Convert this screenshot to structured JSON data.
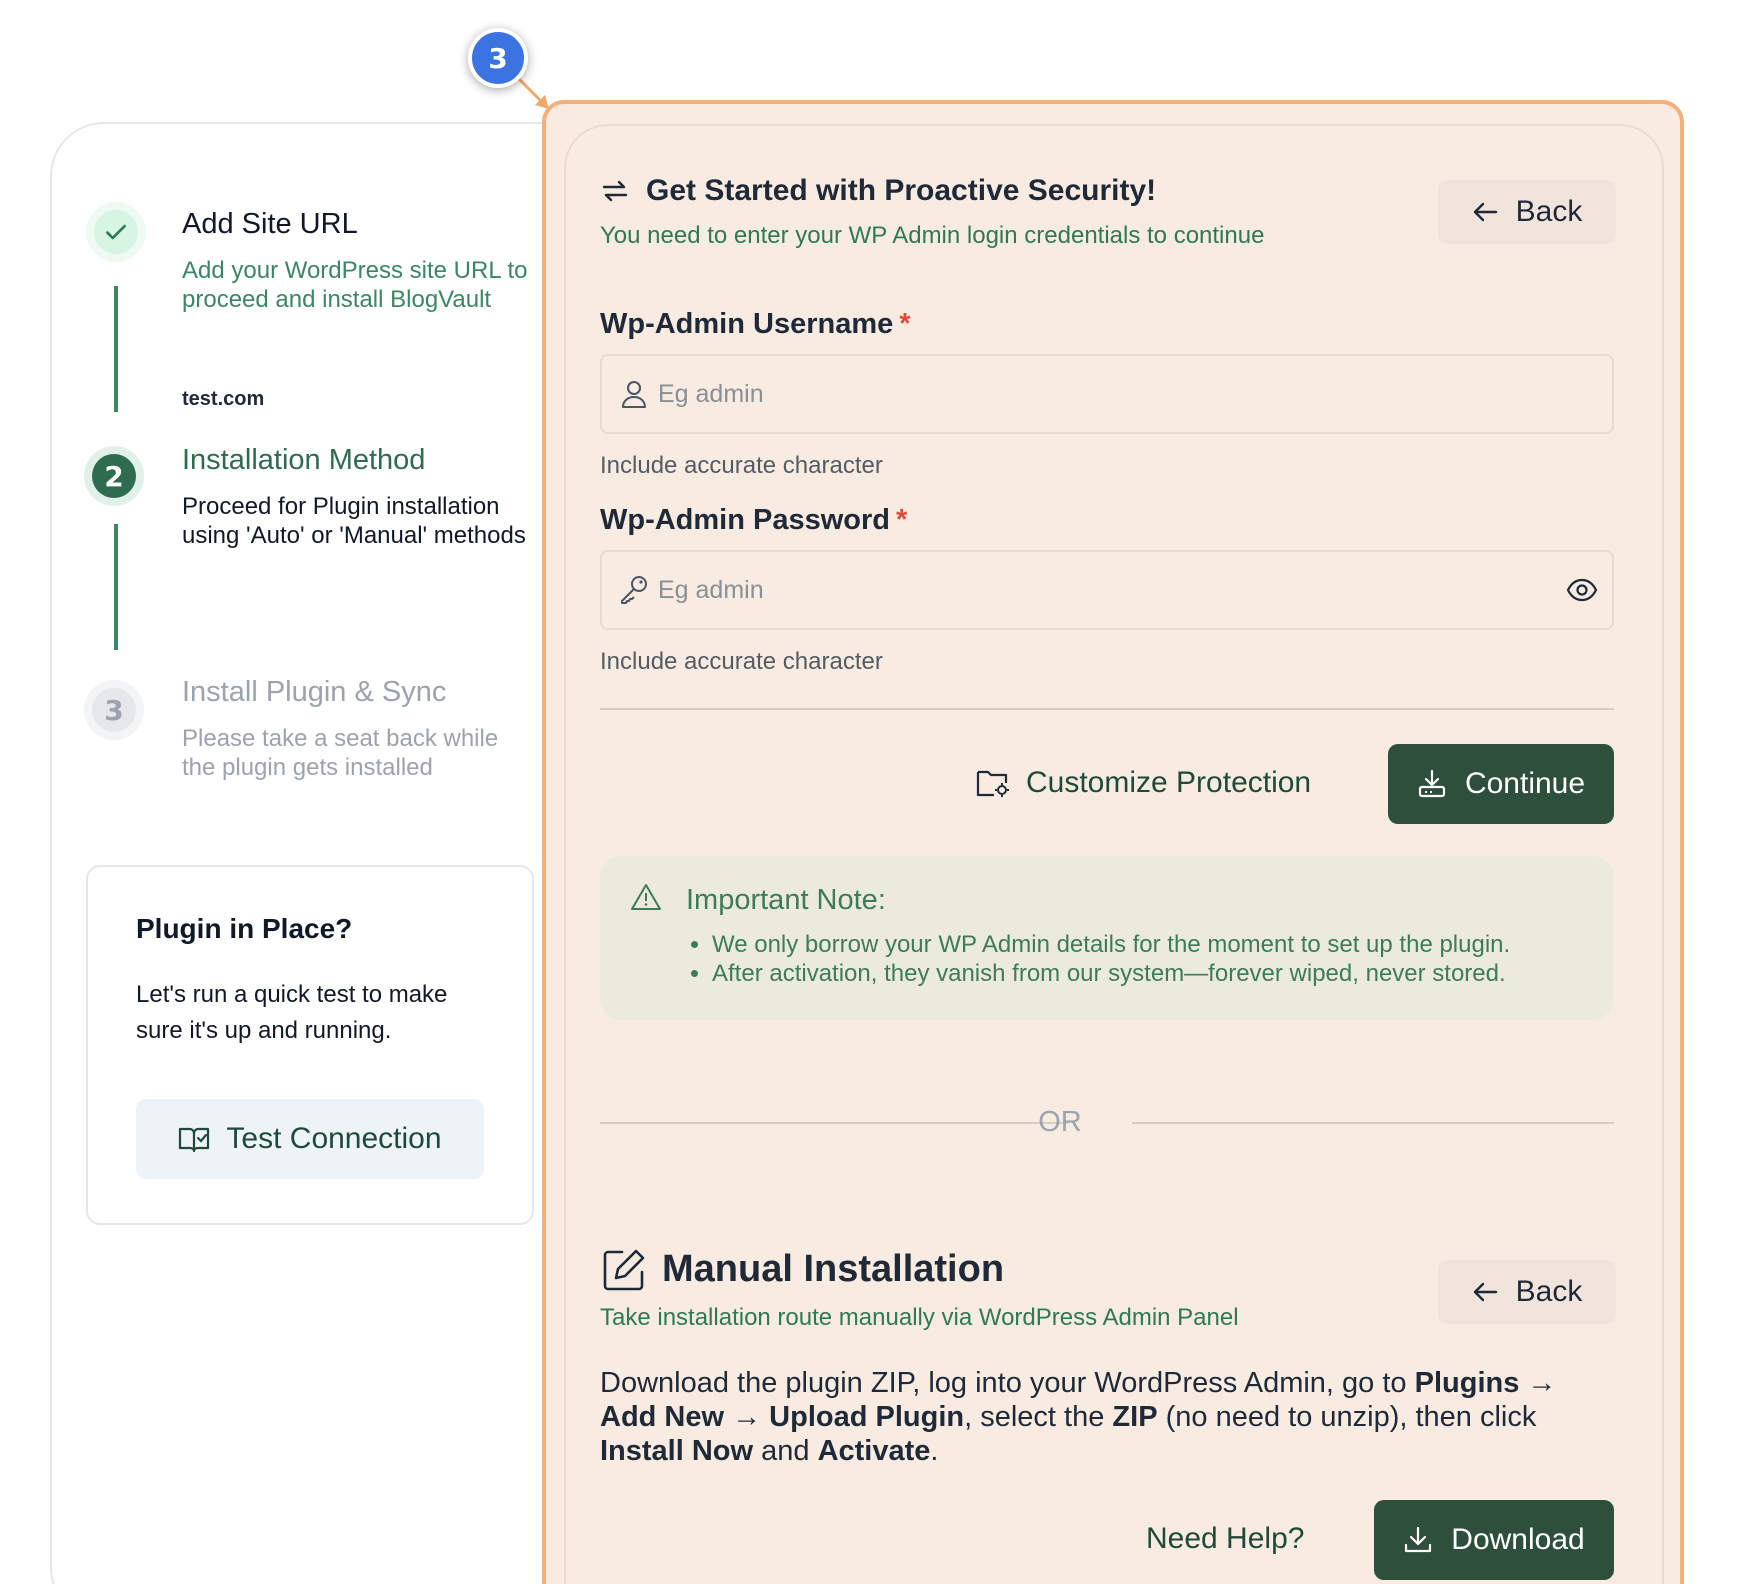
{
  "highlight_badge": "3",
  "steps": [
    {
      "number": "",
      "title": "Add Site URL",
      "description": "Add your WordPress site URL to proceed and install BlogVault",
      "value": "test.com",
      "state": "done"
    },
    {
      "number": "2",
      "title": "Installation Method",
      "description": "Proceed for Plugin installation using 'Auto' or 'Manual' methods",
      "state": "active"
    },
    {
      "number": "3",
      "title": "Install Plugin & Sync",
      "description": "Please take a seat back while the plugin gets installed",
      "state": "pending"
    }
  ],
  "plugin_check": {
    "title": "Plugin in Place?",
    "text": "Let's run a quick test to make sure it's up and running.",
    "button_label": "Test Connection"
  },
  "auto_install": {
    "title": "Get Started with Proactive Security!",
    "subtitle": "You need to enter your WP Admin login credentials to continue",
    "back_label": "Back",
    "username": {
      "label": "Wp-Admin Username",
      "required_mark": "*",
      "placeholder": "Eg admin",
      "value": "",
      "hint": "Include accurate character"
    },
    "password": {
      "label": "Wp-Admin Password",
      "required_mark": "*",
      "placeholder": "Eg admin",
      "value": "",
      "hint": "Include accurate character"
    },
    "customize_label": "Customize Protection",
    "continue_label": "Continue",
    "note": {
      "title": "Important Note:",
      "items": [
        "We only borrow your WP Admin details for the moment to set up the plugin.",
        "After activation, they vanish from our system—forever wiped, never stored."
      ]
    }
  },
  "separator_text": "OR",
  "manual_install": {
    "title": "Manual Installation",
    "subtitle": "Take installation route manually via WordPress Admin Panel",
    "back_label": "Back",
    "instructions": [
      {
        "text": "Download the plugin ZIP, log into your WordPress Admin, go to ",
        "bold": false
      },
      {
        "text": "Plugins → Add New → Upload Plugin",
        "bold": true
      },
      {
        "text": ", select the ",
        "bold": false
      },
      {
        "text": "ZIP",
        "bold": true
      },
      {
        "text": " (no need to unzip), then click ",
        "bold": false
      },
      {
        "text": "Install Now",
        "bold": true
      },
      {
        "text": " and ",
        "bold": false
      },
      {
        "text": "Activate",
        "bold": true
      },
      {
        "text": ".",
        "bold": false
      }
    ],
    "help_label": "Need Help?",
    "download_label": "Download"
  },
  "colors": {
    "accent_green": "#2e4f3b",
    "step_green": "#2e6b4f",
    "highlight_border": "#f3b07b",
    "badge_blue": "#3b74e0"
  }
}
